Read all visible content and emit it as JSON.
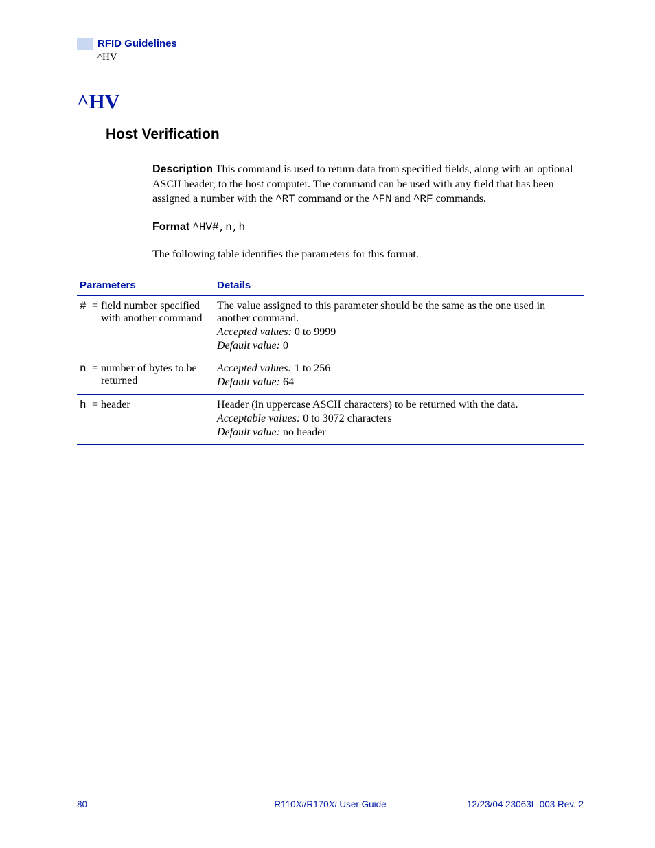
{
  "header": {
    "guideline_title": "RFID Guidelines",
    "guideline_sub": "^HV"
  },
  "command": {
    "title": "^HV",
    "section": "Host Verification"
  },
  "description": {
    "label": "Description",
    "text_before_rt": "This command is used to return data from specified fields, along with an optional ASCII header, to the host computer. The command can be used with any field that has been assigned a number with the ",
    "code_rt": "^RT",
    "text_mid": " command or the ",
    "code_fn": "^FN",
    "text_and": " and ",
    "code_rf": "^RF",
    "text_end": " commands."
  },
  "format": {
    "label": "Format",
    "code": "^HV#,n,h"
  },
  "table_intro": "The following table identifies the parameters for this format.",
  "table": {
    "col1": "Parameters",
    "col2": "Details",
    "rows": [
      {
        "sym": "#",
        "eq": "=",
        "desc": "field number specified with another command",
        "d1": "The value assigned to this parameter should be the same as the one used in another command.",
        "d2_label": "Accepted values:",
        "d2_val": " 0 to 9999",
        "d3_label": "Default value:",
        "d3_val": " 0"
      },
      {
        "sym": "n",
        "eq": "=",
        "desc": "number of bytes to be returned",
        "d2_label": "Accepted values:",
        "d2_val": " 1 to 256",
        "d3_label": "Default value:",
        "d3_val": " 64"
      },
      {
        "sym": "h",
        "eq": "=",
        "desc": "header",
        "d1": "Header (in uppercase ASCII characters) to be returned with the data.",
        "d2_label": "Acceptable values:",
        "d2_val": " 0 to 3072 characters",
        "d3_label": "Default value:",
        "d3_val": " no header"
      }
    ]
  },
  "footer": {
    "page": "80",
    "center_pre": "R110",
    "center_it1": "Xi",
    "center_mid": "/R170",
    "center_it2": "Xi",
    "center_post": " User Guide",
    "right": "12/23/04  23063L-003 Rev. 2"
  }
}
